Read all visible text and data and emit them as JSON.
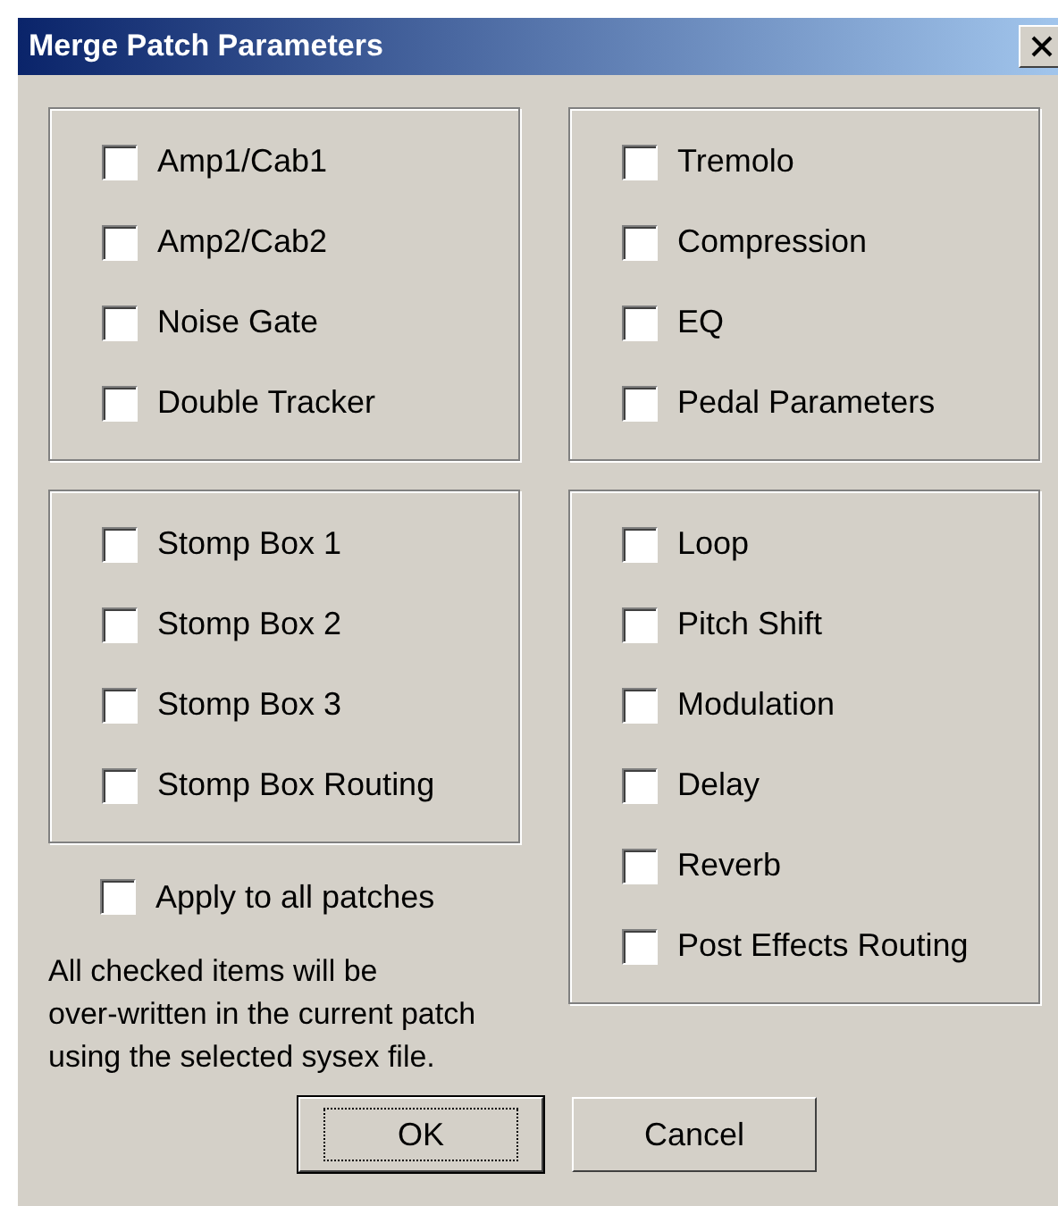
{
  "window": {
    "title": "Merge Patch Parameters"
  },
  "columns": [
    {
      "groups": [
        {
          "items": [
            {
              "label": "Amp1/Cab1",
              "checked": false
            },
            {
              "label": "Amp2/Cab2",
              "checked": false
            },
            {
              "label": "Noise Gate",
              "checked": false
            },
            {
              "label": "Double Tracker",
              "checked": false
            }
          ]
        },
        {
          "items": [
            {
              "label": "Stomp Box 1",
              "checked": false
            },
            {
              "label": "Stomp Box 2",
              "checked": false
            },
            {
              "label": "Stomp Box 3",
              "checked": false
            },
            {
              "label": "Stomp Box Routing",
              "checked": false
            }
          ]
        }
      ]
    },
    {
      "groups": [
        {
          "items": [
            {
              "label": "Tremolo",
              "checked": false
            },
            {
              "label": "Compression",
              "checked": false
            },
            {
              "label": "EQ",
              "checked": false
            },
            {
              "label": "Pedal Parameters",
              "checked": false
            }
          ]
        },
        {
          "items": [
            {
              "label": "Loop",
              "checked": false
            },
            {
              "label": "Pitch Shift",
              "checked": false
            },
            {
              "label": "Modulation",
              "checked": false
            },
            {
              "label": "Delay",
              "checked": false
            },
            {
              "label": "Reverb",
              "checked": false
            },
            {
              "label": "Post Effects Routing",
              "checked": false
            }
          ]
        }
      ]
    }
  ],
  "apply_all": {
    "label": "Apply to all patches",
    "checked": false
  },
  "note": "All checked items will be\nover-written in the current patch\nusing the selected sysex file.",
  "buttons": [
    {
      "label": "OK",
      "default": true
    },
    {
      "label": "Cancel",
      "default": false
    }
  ]
}
